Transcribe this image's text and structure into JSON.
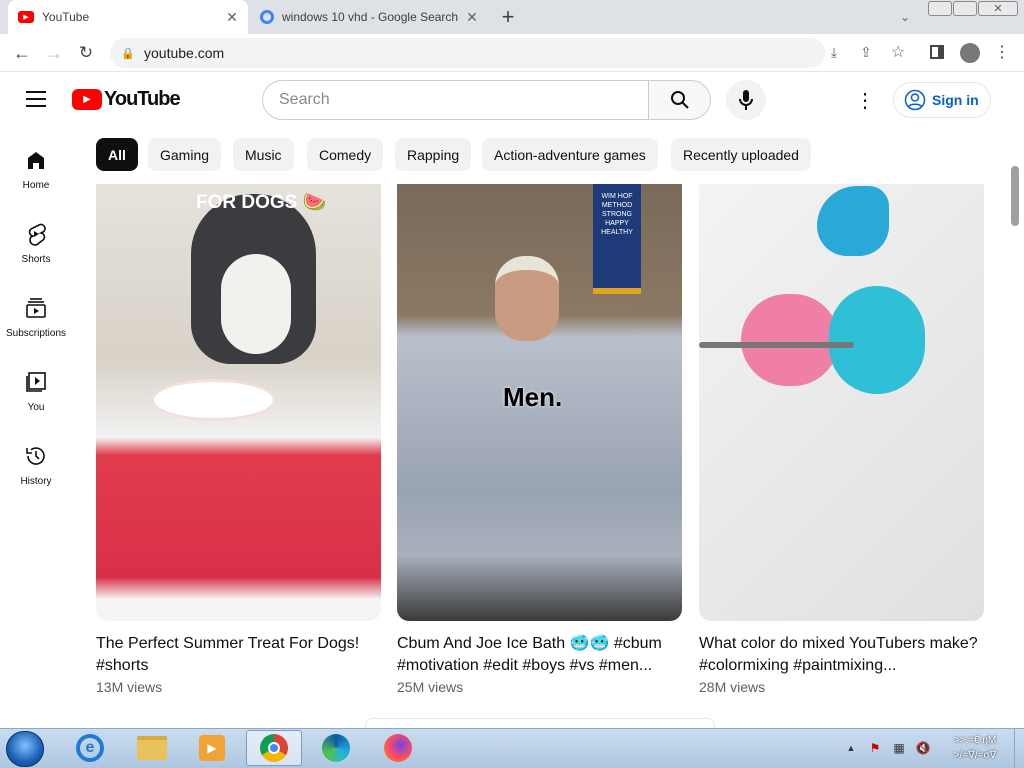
{
  "browser": {
    "tabs": [
      {
        "title": "YouTube",
        "close": "✕"
      },
      {
        "title": "windows 10 vhd - Google Search",
        "close": "✕"
      }
    ],
    "new_tab": "+",
    "url": "youtube.com"
  },
  "youtube": {
    "logo_text": "YouTube",
    "search_placeholder": "Search",
    "signin": "Sign in",
    "chips": [
      "All",
      "Gaming",
      "Music",
      "Comedy",
      "Rapping",
      "Action-adventure games",
      "Recently uploaded"
    ],
    "sidebar": [
      {
        "label": "Home",
        "icon": "home-icon"
      },
      {
        "label": "Shorts",
        "icon": "shorts-icon"
      },
      {
        "label": "Subscriptions",
        "icon": "subscriptions-icon"
      },
      {
        "label": "You",
        "icon": "you-icon"
      },
      {
        "label": "History",
        "icon": "history-icon"
      }
    ],
    "videos": [
      {
        "title": "The Perfect Summer Treat For Dogs! #shorts",
        "views": "13M views",
        "overlay": "FOR DOGS 🍉"
      },
      {
        "title": "Cbum And Joe Ice Bath 🥶🥶 #cbum #motivation #edit #boys #vs #men...",
        "views": "25M views",
        "overlay": "Men.",
        "banner": "WIM HOF METHOD STRONG HAPPY HEALTHY"
      },
      {
        "title": "What color do mixed YouTubers make? #colormixing #paintmixing...",
        "views": "28M views",
        "overlay": ""
      }
    ]
  },
  "taskbar": {
    "clock_line1": ">>:=€ ηΜ",
    "clock_line2": ">/=∇/=σ∇"
  }
}
